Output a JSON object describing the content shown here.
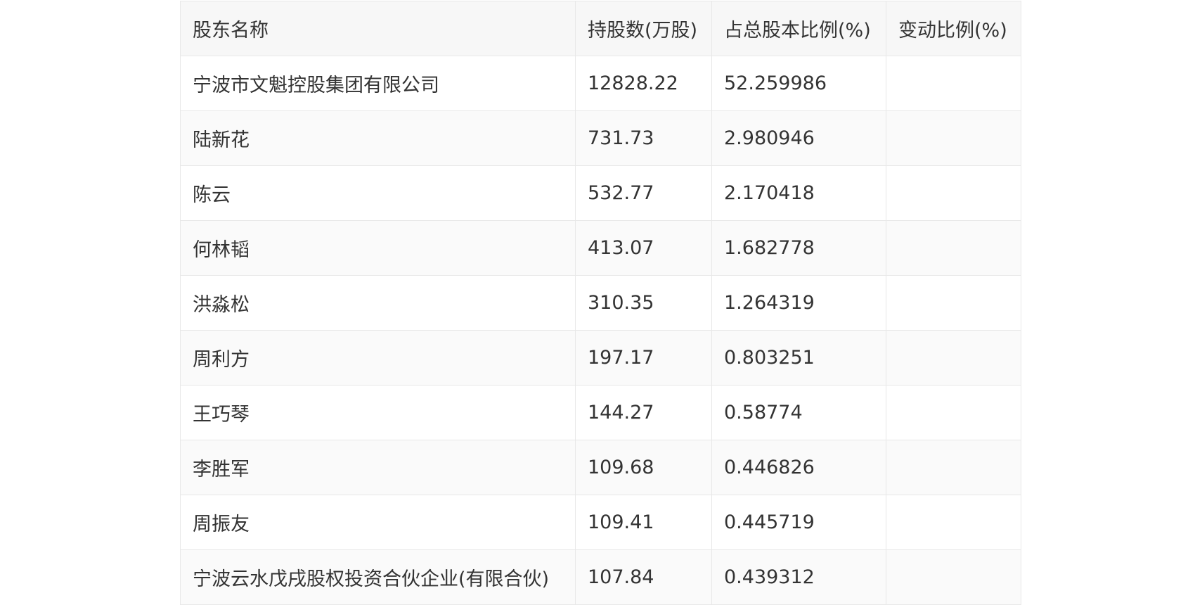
{
  "table": {
    "headers": [
      "股东名称",
      "持股数(万股)",
      "占总股本比例(%)",
      "变动比例(%)"
    ],
    "rows": [
      [
        "宁波市文魁控股集团有限公司",
        "12828.22",
        "52.259986",
        ""
      ],
      [
        "陆新花",
        "731.73",
        "2.980946",
        ""
      ],
      [
        "陈云",
        "532.77",
        "2.170418",
        ""
      ],
      [
        "何林韬",
        "413.07",
        "1.682778",
        ""
      ],
      [
        "洪淼松",
        "310.35",
        "1.264319",
        ""
      ],
      [
        "周利方",
        "197.17",
        "0.803251",
        ""
      ],
      [
        "王巧琴",
        "144.27",
        "0.58774",
        ""
      ],
      [
        "李胜军",
        "109.68",
        "0.446826",
        ""
      ],
      [
        "周振友",
        "109.41",
        "0.445719",
        ""
      ],
      [
        "宁波云水戊戌股权投资合伙企业(有限合伙)",
        "107.84",
        "0.439312",
        ""
      ]
    ]
  }
}
